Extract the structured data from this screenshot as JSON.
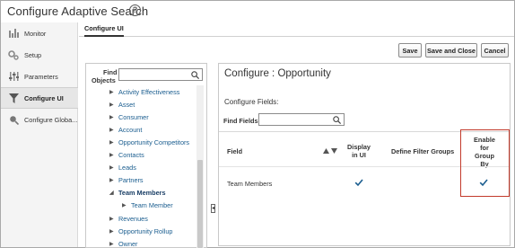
{
  "page": {
    "title": "Configure Adaptive Search"
  },
  "sidebar": {
    "items": [
      {
        "label": "Monitor",
        "icon": "bar-chart-icon",
        "active": false
      },
      {
        "label": "Setup",
        "icon": "gears-icon",
        "active": false
      },
      {
        "label": "Parameters",
        "icon": "sliders-icon",
        "active": false
      },
      {
        "label": "Configure UI",
        "icon": "filter-icon",
        "active": true
      },
      {
        "label": "Configure Globa...",
        "icon": "globe-search-icon",
        "active": false
      }
    ]
  },
  "tabs": {
    "configure_ui": "Configure UI"
  },
  "toolbar": {
    "save": "Save",
    "save_and_close": "Save and Close",
    "cancel": "Cancel"
  },
  "left_panel": {
    "find_label_line1": "Find",
    "find_label_line2": "Objects",
    "find_value": "",
    "tree": [
      {
        "label": "Activity Effectiveness",
        "expanded": false,
        "level": 0
      },
      {
        "label": "Asset",
        "expanded": false,
        "level": 0
      },
      {
        "label": "Consumer",
        "expanded": false,
        "level": 0
      },
      {
        "label": "Account",
        "expanded": false,
        "level": 0
      },
      {
        "label": "Opportunity Competitors",
        "expanded": false,
        "level": 0
      },
      {
        "label": "Contacts",
        "expanded": false,
        "level": 0
      },
      {
        "label": "Leads",
        "expanded": false,
        "level": 0
      },
      {
        "label": "Partners",
        "expanded": false,
        "level": 0
      },
      {
        "label": "Team Members",
        "expanded": true,
        "level": 0
      },
      {
        "label": "Team Member",
        "expanded": false,
        "level": 1
      },
      {
        "label": "Revenues",
        "expanded": false,
        "level": 0
      },
      {
        "label": "Opportunity Rollup",
        "expanded": false,
        "level": 0
      },
      {
        "label": "Owner",
        "expanded": false,
        "level": 0
      }
    ]
  },
  "right_panel": {
    "title": "Configure : Opportunity",
    "subtitle": "Configure Fields:",
    "find_fields_label": "Find Fields",
    "find_fields_value": "",
    "columns": {
      "field": "Field",
      "display_l1": "Display",
      "display_l2": "in UI",
      "filter_groups": "Define Filter Groups",
      "group_l1": "Enable",
      "group_l2": "for",
      "group_l3": "Group",
      "group_l4": "By"
    },
    "rows": [
      {
        "field": "Team Members",
        "display_in_ui": true,
        "enable_group_by": true
      }
    ]
  },
  "colors": {
    "link": "#1a5d8f",
    "checkbox_accent": "#1a5d8f",
    "highlight": "#c23a2b"
  }
}
